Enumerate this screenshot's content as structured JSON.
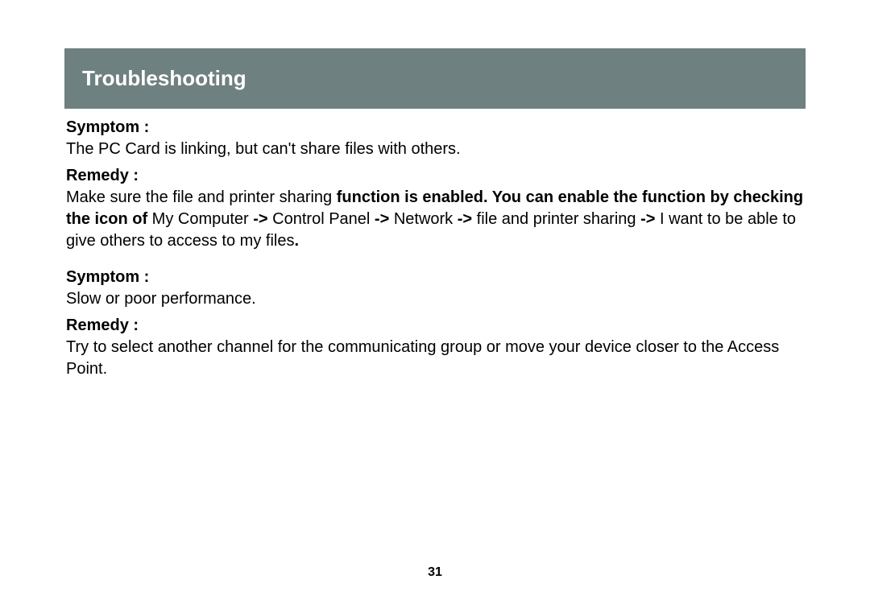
{
  "title": "Troubleshooting",
  "sections": [
    {
      "symptom_label": "Symptom :",
      "symptom_text": "The PC Card is linking, but can't share files with others.",
      "remedy_label": "Remedy :",
      "remedy_parts": {
        "pre": "Make sure the file and printer sharing ",
        "bold1": "function is enabled. You can enable the function by checking the icon of ",
        "mid1": "My Computer ",
        "arrow1": "-> ",
        "mid2": "Control Panel ",
        "arrow2": "-> ",
        "mid3": "Network ",
        "arrow3": "-> ",
        "mid4": "file and printer sharing ",
        "arrow4": "-> ",
        "post": "I want to be able to give others to access to my files",
        "dot": "."
      }
    },
    {
      "symptom_label": "Symptom :",
      "symptom_text": "Slow or poor performance.",
      "remedy_label": "Remedy :",
      "remedy_text": "Try to select another channel for the communicating group or move your device closer to the Access Point."
    }
  ],
  "page_number": "31"
}
